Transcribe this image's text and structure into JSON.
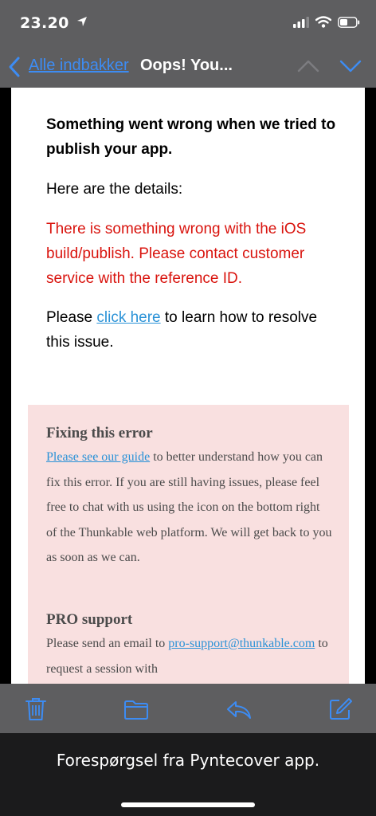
{
  "status_bar": {
    "time": "23.20"
  },
  "navbar": {
    "back_label": "Alle indbakker",
    "title": "Oops! You..."
  },
  "mail": {
    "heading": "Something went wrong when we tried to publish your app.",
    "details": "Here are the details:",
    "error_message": "There is something wrong with the iOS build/publish. Please contact customer service with the reference ID.",
    "resolve_before": "Please ",
    "resolve_link": "click here",
    "resolve_after": " to learn how to resolve this issue.",
    "fixing": {
      "title": "Fixing this error",
      "guide_link": "Please see our guide",
      "body": " to better understand how you can fix this error. If you are still having issues, please feel free to chat with us using the icon on the bottom right of the Thunkable web platform. We will get back to you as soon as we can."
    },
    "pro": {
      "title": "PRO support",
      "text_before": "Please send an email to ",
      "email_link": "pro-support@thunkable.com",
      "text_after": " to request a session with"
    }
  },
  "banner": {
    "text": "Forespørgsel fra Pyntecover app."
  },
  "colors": {
    "accent": "#3d8cf3",
    "error": "#d9140e",
    "link": "#2a92d7",
    "box_bg": "#f9e0e0",
    "bar_bg": "#5e5e60"
  },
  "icons": [
    "location-arrow-icon",
    "cellular-signal-icon",
    "wifi-icon",
    "battery-icon",
    "back-chevron-icon",
    "chevron-up-icon",
    "chevron-down-icon",
    "trash-icon",
    "folder-icon",
    "reply-icon",
    "compose-icon"
  ]
}
